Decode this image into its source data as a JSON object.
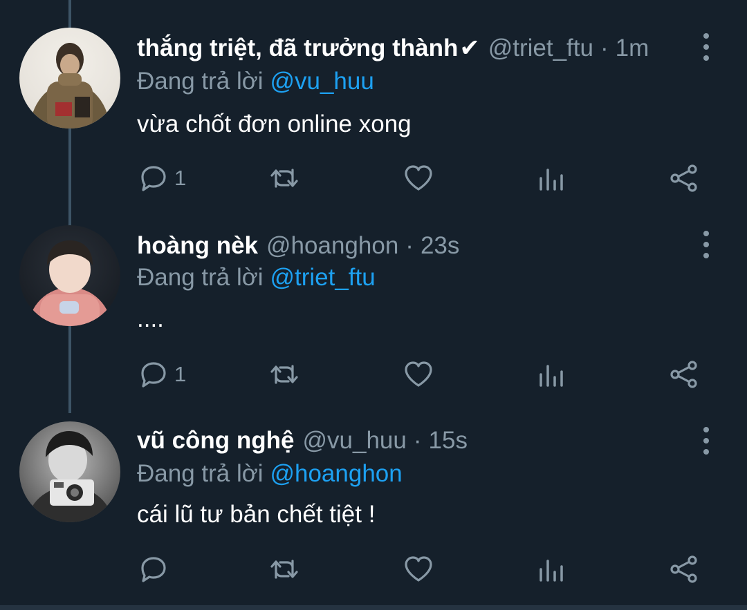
{
  "tweets": [
    {
      "name": "thắng triệt, đã trưởng thành",
      "verified_glyph": "✔",
      "handle": "@triet_ftu",
      "separator": "·",
      "time": "1m",
      "reply_prefix": "Đang trả lời",
      "reply_to": "@vu_huu",
      "text": "vừa chốt đơn online xong",
      "reply_count": "1"
    },
    {
      "name": "hoàng nèk",
      "handle": "@hoanghon",
      "separator": "·",
      "time": "23s",
      "reply_prefix": "Đang trả lời",
      "reply_to": "@triet_ftu",
      "text": "....",
      "reply_count": "1"
    },
    {
      "name": "vũ công nghệ",
      "handle": "@vu_huu",
      "separator": "·",
      "time": "15s",
      "reply_prefix": "Đang trả lời",
      "reply_to": "@hoanghon",
      "text": "cái lũ tư bản chết tiệt !",
      "reply_count": ""
    }
  ],
  "icons": {
    "reply": "reply-icon",
    "retweet": "retweet-icon",
    "like": "heart-icon",
    "stats": "analytics-icon",
    "share": "share-icon",
    "more": "more-vertical-icon"
  },
  "colors": {
    "background": "#15202b",
    "secondary_text": "#8899a6",
    "mention": "#1da1f2",
    "thread_line": "#3d5466"
  }
}
